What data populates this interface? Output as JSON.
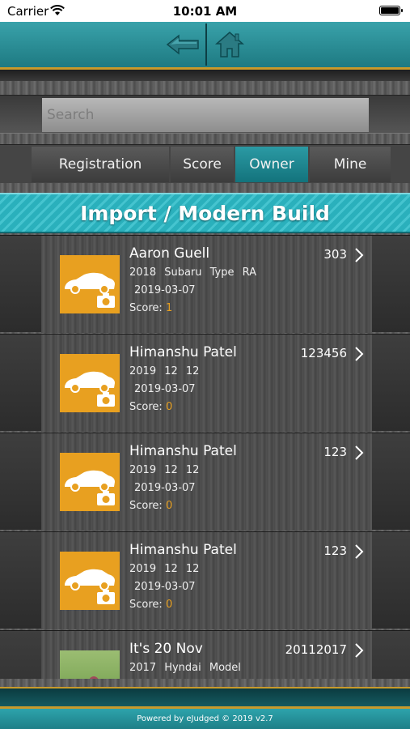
{
  "status_bar": {
    "carrier": "Carrier",
    "time": "10:01 AM"
  },
  "header": {
    "back_icon": "back-arrow-icon",
    "home_icon": "home-icon"
  },
  "search": {
    "placeholder": "Search",
    "value": ""
  },
  "tabs": [
    {
      "label": "Registration",
      "active": false
    },
    {
      "label": "Score",
      "active": false
    },
    {
      "label": "Owner",
      "active": true
    },
    {
      "label": "Mine",
      "active": false
    }
  ],
  "section_title": "Import / Modern Build",
  "score_label": "Score:",
  "entries": [
    {
      "owner": "Aaron Guell",
      "number": "303",
      "vehicle": "2018 Subaru Type RA",
      "date": "2019-03-07",
      "score": "1",
      "thumb": "car-placeholder"
    },
    {
      "owner": "Himanshu Patel",
      "number": "123456",
      "vehicle": "2019 12 12",
      "date": "2019-03-07",
      "score": "0",
      "thumb": "car-placeholder"
    },
    {
      "owner": "Himanshu Patel",
      "number": "123",
      "vehicle": "2019 12 12",
      "date": "2019-03-07",
      "score": "0",
      "thumb": "car-placeholder"
    },
    {
      "owner": "Himanshu Patel",
      "number": "123",
      "vehicle": "2019 12 12",
      "date": "2019-03-07",
      "score": "0",
      "thumb": "car-placeholder"
    },
    {
      "owner": "It's 20 Nov",
      "number": "20112017",
      "vehicle": "2017 Hyndai Model",
      "date": "",
      "score": "",
      "thumb": "photo"
    }
  ],
  "footer": {
    "text": "Powered by eJudged © 2019 v2.7"
  },
  "colors": {
    "accent": "#2a9aa4",
    "gold": "#c89a2c",
    "thumb_orange": "#e8a020"
  }
}
